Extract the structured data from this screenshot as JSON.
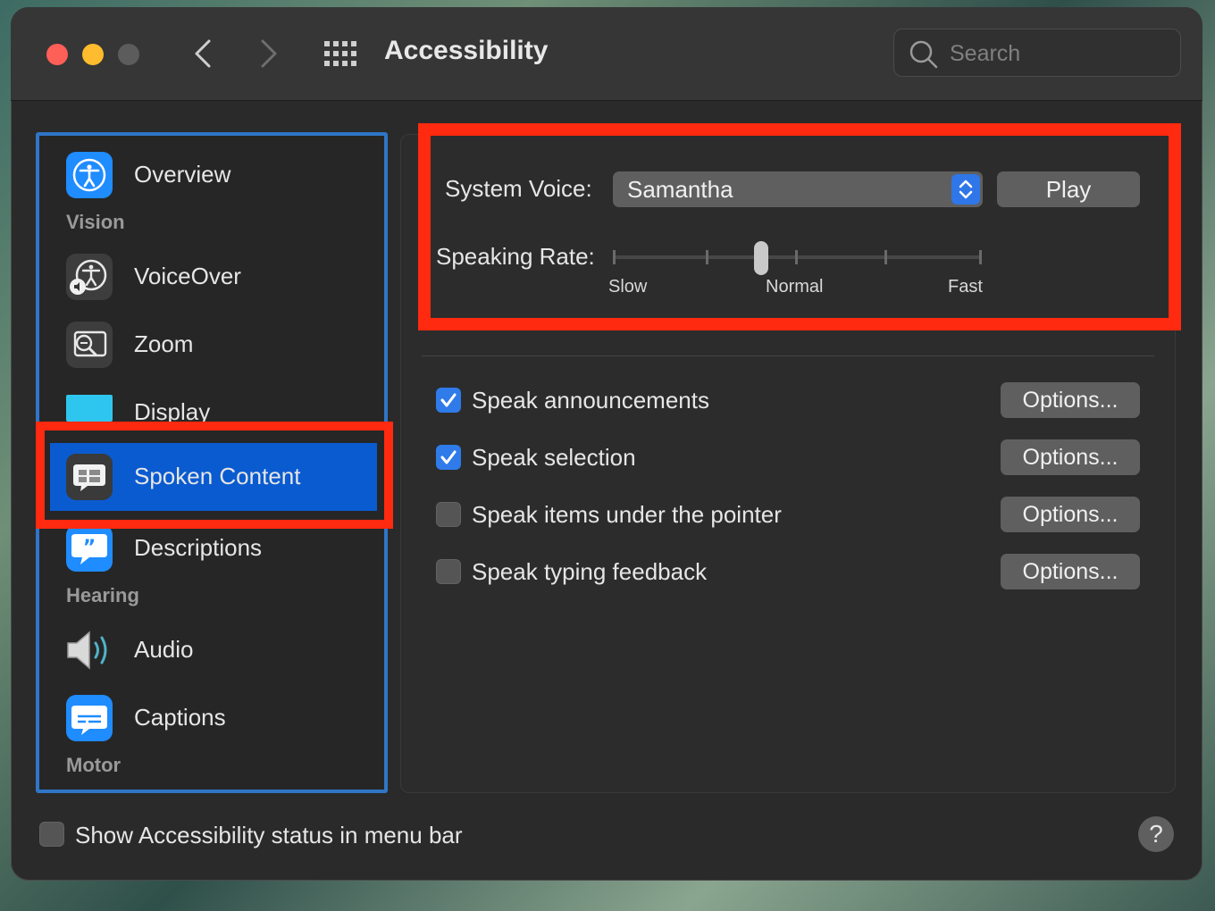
{
  "window": {
    "title": "Accessibility",
    "search": {
      "placeholder": "Search",
      "value": ""
    }
  },
  "sidebar": {
    "sections": {
      "vision": "Vision",
      "hearing": "Hearing",
      "motor": "Motor"
    },
    "items": [
      {
        "label": "Overview",
        "icon": "accessibility-icon"
      },
      {
        "label": "VoiceOver",
        "icon": "voiceover-icon"
      },
      {
        "label": "Zoom",
        "icon": "zoom-icon"
      },
      {
        "label": "Display",
        "icon": "display-icon"
      },
      {
        "label": "Spoken Content",
        "icon": "speech-bubble-icon",
        "selected": true
      },
      {
        "label": "Descriptions",
        "icon": "quote-bubble-icon"
      },
      {
        "label": "Audio",
        "icon": "speaker-icon"
      },
      {
        "label": "Captions",
        "icon": "captions-icon"
      }
    ]
  },
  "spoken_content": {
    "system_voice_label": "System Voice:",
    "system_voice_value": "Samantha",
    "play_label": "Play",
    "speaking_rate_label": "Speaking Rate:",
    "rate_ticks": {
      "slow": "Slow",
      "normal": "Normal",
      "fast": "Fast"
    },
    "speaking_rate_fraction": 0.4,
    "options": [
      {
        "label": "Speak announcements",
        "checked": true,
        "button": "Options..."
      },
      {
        "label": "Speak selection",
        "checked": true,
        "button": "Options..."
      },
      {
        "label": "Speak items under the pointer",
        "checked": false,
        "button": "Options..."
      },
      {
        "label": "Speak typing feedback",
        "checked": false,
        "button": "Options..."
      }
    ]
  },
  "footer": {
    "show_status_label": "Show Accessibility status in menu bar",
    "show_status_checked": false,
    "help_label": "?"
  },
  "colors": {
    "accent": "#0a5bd0",
    "highlight": "#ff2a0f",
    "checkbox_on": "#2f7bea"
  }
}
